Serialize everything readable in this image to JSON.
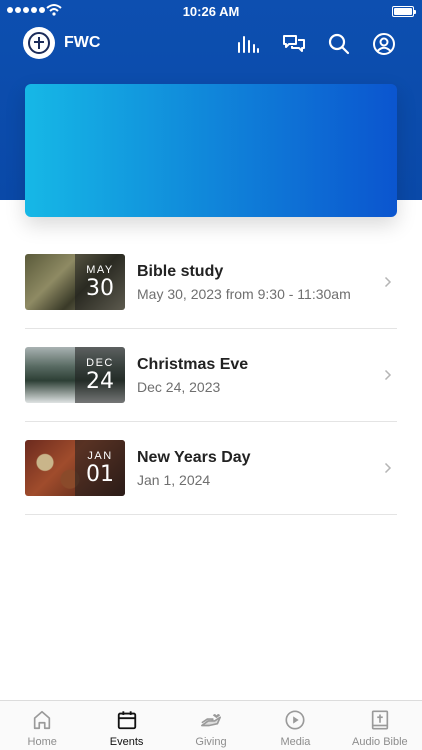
{
  "status_bar": {
    "time": "10:26 AM"
  },
  "header": {
    "app_title": "FWC"
  },
  "nav_icons": [
    "stats-icon",
    "chat-icon",
    "search-icon",
    "profile-icon"
  ],
  "events": [
    {
      "month": "MAY",
      "day": "30",
      "title": "Bible study",
      "subtitle": "May 30, 2023 from 9:30 - 11:30am"
    },
    {
      "month": "DEC",
      "day": "24",
      "title": "Christmas Eve",
      "subtitle": "Dec 24, 2023"
    },
    {
      "month": "JAN",
      "day": "01",
      "title": "New Years Day",
      "subtitle": "Jan 1, 2024"
    }
  ],
  "tabbar": {
    "active": "Events",
    "tabs": [
      {
        "label": "Home",
        "icon": "home-icon"
      },
      {
        "label": "Events",
        "icon": "calendar-icon"
      },
      {
        "label": "Giving",
        "icon": "giving-hand-icon"
      },
      {
        "label": "Media",
        "icon": "play-icon"
      },
      {
        "label": "Audio Bible",
        "icon": "bible-icon"
      }
    ]
  },
  "colors": {
    "header": "#0d4fb0",
    "hero_start": "#16b8e6",
    "hero_end": "#0b55cf"
  }
}
